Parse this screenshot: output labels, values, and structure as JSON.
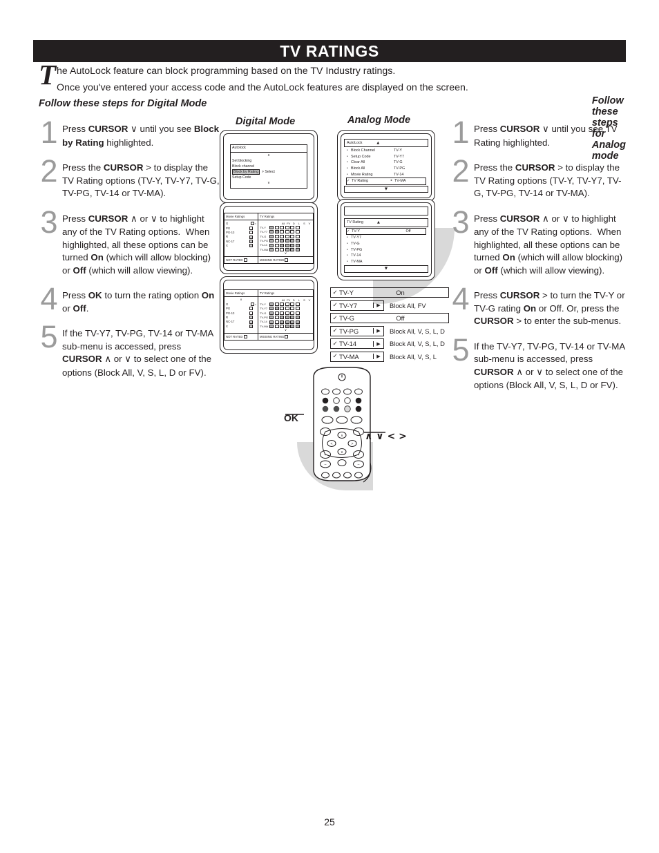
{
  "page": {
    "title": "TV RATINGS",
    "page_number": "25",
    "intro_dropcap": "T",
    "intro_line1": "he AutoLock feature can block programming based on the TV Industry ratings.",
    "intro_line2": "Once you've entered your access code and the AutoLock features are displayed on the screen.",
    "follow_left": "Follow these steps for Digital Mode",
    "follow_right": "Follow these steps for Analog mode",
    "accent_dark": "#231f20",
    "step_number_color": "#9b9b9b",
    "shadow_gray": "#d9d9d9"
  },
  "digital_steps": [
    {
      "num": "1",
      "html": "Press <b>CURSOR</b> <span class='arrowch'>&#8744;</span> until you see <b>Block by Rating</b> highlighted."
    },
    {
      "num": "2",
      "html": "Press the <b>CURSOR</b> &gt; to display the TV Rating options (TV-Y, TV-Y7, TV-G, TV-PG, TV-14 or TV-MA)."
    },
    {
      "num": "3",
      "html": "Press <b>CURSOR</b> <span class='arrowch'>&#8743;</span> or <span class='arrowch'>&#8744;</span> to highlight any of the TV Rating options.&nbsp; When highlighted, all these options can be turned <b>On</b> (which will allow blocking) or <b>Off</b> (which will allow viewing)."
    },
    {
      "num": "4",
      "html": "Press <b>OK</b> to turn the rating option <b>On</b> or <b>Off</b>."
    },
    {
      "num": "5",
      "html": "If the TV-Y7, TV-PG, TV-14 or TV-MA sub-menu is accessed, press <b>CURSOR</b> <span class='arrowch'>&#8743;</span> or <span class='arrowch'>&#8744;</span> to select one of the options (Block All, V, S, L, D or FV)."
    }
  ],
  "analog_steps": [
    {
      "num": "1",
      "html": "Press <b>CURSOR</b> <span class='arrowch'>&#8744;</span> until you see TV Rating highlighted."
    },
    {
      "num": "2",
      "html": "Press the <b>CURSOR</b> &gt; to display the TV Rating options (TV-Y, TV-Y7, TV-G, TV-PG, TV-14 or TV-MA)."
    },
    {
      "num": "3",
      "html": "Press <b>CURSOR</b> <span class='arrowch'>&#8743;</span> or <span class='arrowch'>&#8744;</span> to highlight any of the TV Rating options.&nbsp; When highlighted, all these options can be turned <b>On</b> (which will allow blocking) or <b>Off</b> (which will allow viewing)."
    },
    {
      "num": "4",
      "html": "Press <b>CURSOR</b> &gt; to turn the TV-Y or TV-G rating <b>On</b> or Off. Or, press the <b>CURSOR</b> &gt; to enter the sub-menus."
    },
    {
      "num": "5",
      "html": "If the TV-Y7, TV-PG, TV-14 or TV-MA sub-menu is accessed, press <b>CURSOR</b> <span class='arrowch'>&#8743;</span> or <span class='arrowch'>&#8744;</span> to select one of the options (Block All, V, S, L, D or FV)."
    }
  ],
  "mode_labels": {
    "digital": "Digital Mode",
    "analog": "Analog Mode"
  },
  "digital_screen_1": {
    "header": "Autolock",
    "up_arrow": "∧",
    "down_arrow": "∨",
    "items": [
      {
        "label": "Set blocking",
        "selected": false,
        "hint": ""
      },
      {
        "label": "Block channel",
        "selected": false,
        "hint": ""
      },
      {
        "label": "Block by Rating",
        "selected": true,
        "hint": "> Select"
      },
      {
        "label": "Setup Code",
        "selected": false,
        "hint": ""
      }
    ]
  },
  "ratings_table": {
    "movie_header": "Movie Ratings",
    "tv_header": "TV Ratings",
    "movie_rows": [
      "G",
      "PG",
      "PG-13",
      "R",
      "NC-17",
      "X"
    ],
    "not_rated_label": "NOT RATED",
    "missing_rating_label": "MISSING RATING",
    "tv_columns": [
      "All",
      "FV",
      "D",
      "L",
      "S",
      "V"
    ],
    "tv_rows": [
      "TV-Y",
      "TV-Y7",
      "TV-G",
      "TV-PG",
      "TV-14",
      "TV-MA"
    ]
  },
  "analog_screen_1": {
    "header": "AutoLock",
    "up_arrow": "▲",
    "down_arrow": "▼",
    "items": [
      {
        "bullet": "∘",
        "label": "Block Channel",
        "value": "TV-Y",
        "selected": false
      },
      {
        "bullet": "∘",
        "label": "Setup Code",
        "value": "TV-Y7",
        "selected": false
      },
      {
        "bullet": "∘",
        "label": "Clear All",
        "value": "TV-G",
        "selected": false
      },
      {
        "bullet": "∘",
        "label": "Block All",
        "value": "TV-PG",
        "selected": false
      },
      {
        "bullet": "∘",
        "label": "Movie Rating",
        "value": "TV-14",
        "selected": false
      },
      {
        "bullet": "✓",
        "label": "TV Rating",
        "value": "TV-MA",
        "selected": true,
        "arrow": "▸"
      }
    ]
  },
  "analog_screen_2": {
    "header": "TV Rating",
    "up_arrow": "▲",
    "down_arrow": "▼",
    "items": [
      {
        "bullet": "✓",
        "label": "TV-Y",
        "value": "Off",
        "selected": true
      },
      {
        "bullet": "∘",
        "label": "TV-Y7",
        "value": "",
        "selected": false
      },
      {
        "bullet": "∘",
        "label": "TV-G",
        "value": "",
        "selected": false
      },
      {
        "bullet": "∘",
        "label": "TV-PG",
        "value": "",
        "selected": false
      },
      {
        "bullet": "∘",
        "label": "TV-14",
        "value": "",
        "selected": false
      },
      {
        "bullet": "∘",
        "label": "TV-MA",
        "value": "",
        "selected": false
      }
    ]
  },
  "rating_options": [
    {
      "check": "✓",
      "name": "TV-Y",
      "arrow": "",
      "value": "On",
      "full": true
    },
    {
      "check": "✓",
      "name": "TV-Y7",
      "arrow": "▶",
      "value": "Block All, FV",
      "full": false
    },
    {
      "check": "✓",
      "name": "TV-G",
      "arrow": "",
      "value": "Off",
      "full": true
    },
    {
      "check": "✓",
      "name": "TV-PG",
      "arrow": "▶",
      "value": "Block All, V, S, L, D",
      "full": false
    },
    {
      "check": "✓",
      "name": "TV-14",
      "arrow": "▶",
      "value": "Block All, V, S, L, D",
      "full": false
    },
    {
      "check": "✓",
      "name": "TV-MA",
      "arrow": "▶",
      "value": "Block All, V, S, L",
      "full": false
    }
  ],
  "remote": {
    "ok_label": "OK",
    "nav_label": "∧ ∨ < >"
  }
}
